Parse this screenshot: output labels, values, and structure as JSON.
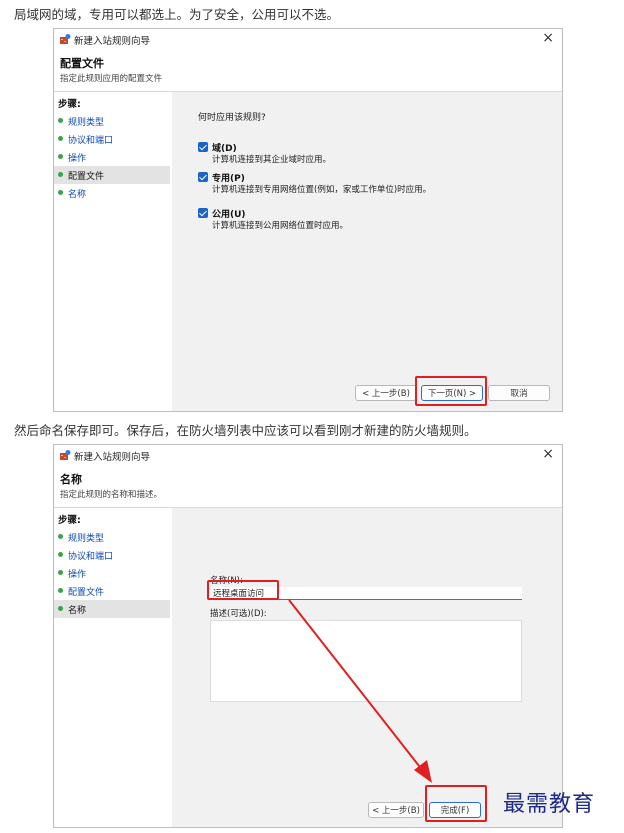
{
  "paragraph_1": "局域网的域，专用可以都选上。为了安全，公用可以不选。",
  "paragraph_2": "然后命名保存即可。保存后，在防火墙列表中应该可以看到刚才新建的防火墙规则。",
  "dialog_1": {
    "window_title": "新建入站规则向导",
    "close": "×",
    "heading": "配置文件",
    "subheading": "指定此规则应用的配置文件",
    "steps_title": "步骤:",
    "steps": [
      {
        "label": "规则类型",
        "current": false
      },
      {
        "label": "协议和端口",
        "current": false
      },
      {
        "label": "操作",
        "current": false
      },
      {
        "label": "配置文件",
        "current": true
      },
      {
        "label": "名称",
        "current": false
      }
    ],
    "question": "何时应用该规则?",
    "options": [
      {
        "label": "域(D)",
        "desc": "计算机连接到其企业域时应用。",
        "checked": true
      },
      {
        "label": "专用(P)",
        "desc": "计算机连接到专用网络位置(例如，家或工作单位)时应用。",
        "checked": true
      },
      {
        "label": "公用(U)",
        "desc": "计算机连接到公用网络位置时应用。",
        "checked": true
      }
    ],
    "buttons": {
      "back": "< 上一步(B)",
      "next": "下一页(N) >",
      "cancel": "取消"
    }
  },
  "dialog_2": {
    "window_title": "新建入站规则向导",
    "close": "×",
    "heading": "名称",
    "subheading": "指定此规则的名称和描述。",
    "steps_title": "步骤:",
    "steps": [
      {
        "label": "规则类型",
        "current": false
      },
      {
        "label": "协议和端口",
        "current": false
      },
      {
        "label": "操作",
        "current": false
      },
      {
        "label": "配置文件",
        "current": false
      },
      {
        "label": "名称",
        "current": true
      }
    ],
    "name_label": "名称(N):",
    "name_value": "远程桌面访问",
    "desc_label": "描述(可选)(D):",
    "buttons": {
      "back": "< 上一步(B)",
      "finish": "完成(F)"
    }
  },
  "watermark": "最需教育",
  "colors": {
    "accent": "#1a64c8",
    "annotation": "#e02020",
    "step_dot": "#33a64a",
    "watermark": "#1c2a8a"
  }
}
